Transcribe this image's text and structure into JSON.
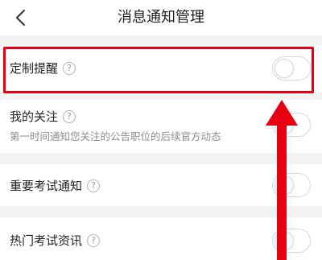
{
  "header": {
    "title": "消息通知管理",
    "back_icon": "chevron-left-icon"
  },
  "settings": [
    {
      "label": "定制提醒",
      "enabled": false
    },
    {
      "label": "我的关注",
      "description": "第一时间通知您关注的公告职位的后续官方动态",
      "enabled": false
    },
    {
      "label": "重要考试通知",
      "enabled": false
    },
    {
      "label": "热门考试资讯",
      "enabled": false
    }
  ],
  "help_icon": "?",
  "colors": {
    "annotation": "#e60012",
    "background": "#f2f2f2",
    "card": "#ffffff"
  }
}
